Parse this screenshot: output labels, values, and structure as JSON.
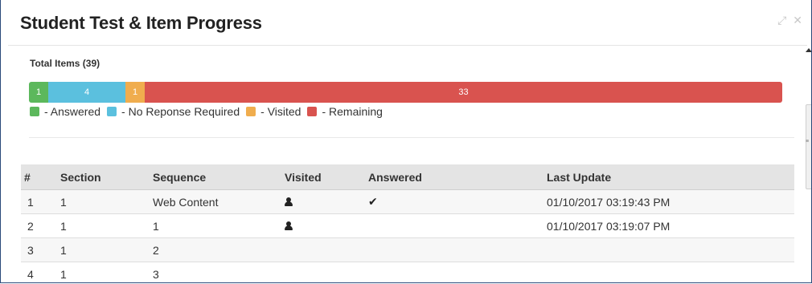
{
  "window": {
    "title": "Student Test & Item Progress",
    "controls": {
      "expand": "⤢",
      "close": "✕"
    }
  },
  "progress": {
    "total_label": "Total Items (39)",
    "total": 39,
    "segments": [
      {
        "key": "answered",
        "count": 1,
        "label": "1",
        "color": "#5cb85c"
      },
      {
        "key": "no_response",
        "count": 4,
        "label": "4",
        "color": "#5bc0de"
      },
      {
        "key": "visited",
        "count": 1,
        "label": "1",
        "color": "#f0ad4e"
      },
      {
        "key": "remaining",
        "count": 33,
        "label": "33",
        "color": "#d9534f"
      }
    ],
    "legend": [
      {
        "label": "- Answered",
        "color": "#5cb85c"
      },
      {
        "label": "- No Reponse Required",
        "color": "#5bc0de"
      },
      {
        "label": "- Visited",
        "color": "#f0ad4e"
      },
      {
        "label": "- Remaining",
        "color": "#d9534f"
      }
    ]
  },
  "table": {
    "headers": {
      "num": "#",
      "section": "Section",
      "sequence": "Sequence",
      "visited": "Visited",
      "answered": "Answered",
      "last_update": "Last Update"
    },
    "rows": [
      {
        "num": "1",
        "section": "1",
        "sequence": "Web Content",
        "visited_icon": "person-icon",
        "answered_icon": "check-icon",
        "last_update": "01/10/2017 03:19:43 PM"
      },
      {
        "num": "2",
        "section": "1",
        "sequence": "1",
        "visited_icon": "person-icon",
        "answered_icon": "",
        "last_update": "01/10/2017 03:19:07 PM"
      },
      {
        "num": "3",
        "section": "1",
        "sequence": "2",
        "visited_icon": "",
        "answered_icon": "",
        "last_update": ""
      },
      {
        "num": "4",
        "section": "1",
        "sequence": "3",
        "visited_icon": "",
        "answered_icon": "",
        "last_update": ""
      }
    ]
  },
  "icons": {
    "check": "✔",
    "scroll_grip": "≡"
  }
}
